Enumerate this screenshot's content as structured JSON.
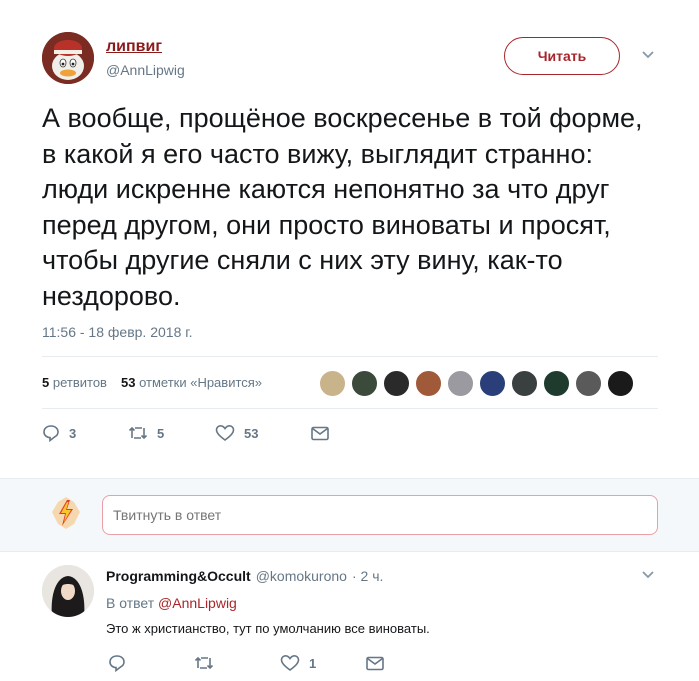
{
  "tweet": {
    "author_name": "липвиг",
    "author_handle": "@AnnLipwig",
    "follow_label": "Читать",
    "text": "А вообще, прощёное воскресенье в той форме, в какой я его часто вижу, выглядит странно: люди искренне каются непонятно за что друг перед другом, они просто виноваты и просят, чтобы другие сняли с них эту вину, как-то нездорово.",
    "timestamp": "11:56 - 18 февр. 2018 г.",
    "retweets_count": "5",
    "retweets_label": "ретвитов",
    "likes_count": "53",
    "likes_label": "отметки «Нравится»",
    "actions": {
      "reply_count": "3",
      "retweet_count": "5",
      "like_count": "53"
    },
    "likers": [
      "#c9b38a",
      "#3b4a3a",
      "#2a2a2a",
      "#a05a3a",
      "#9a9aa0",
      "#2a3f7a",
      "#3a3f40",
      "#1f3b2e",
      "#5a5a5a",
      "#1a1a1a"
    ]
  },
  "reply_box": {
    "placeholder": "Твитнуть в ответ"
  },
  "reply": {
    "name": "Programming&Occult",
    "handle": "@komokurono",
    "time": "· 2 ч.",
    "in_reply_prefix": "В ответ",
    "in_reply_handle": "@AnnLipwig",
    "text": "Это ж христианство, тут по умолчанию все виноваты.",
    "like_count": "1"
  },
  "colors": {
    "accent": "#a8262b",
    "muted": "#657786",
    "text": "#14171a"
  }
}
